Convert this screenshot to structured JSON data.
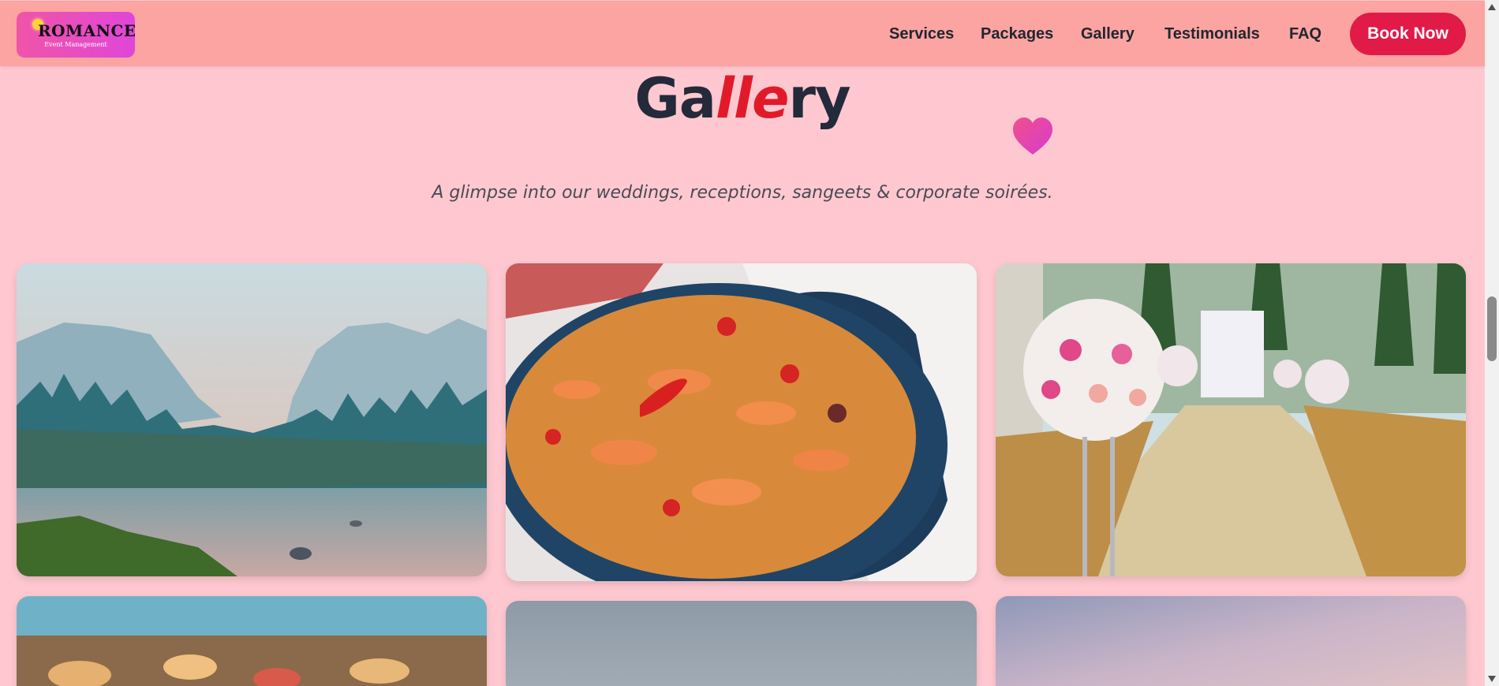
{
  "brand": {
    "logo_text": "ROMANCE",
    "logo_subtitle": "Event Management"
  },
  "nav": {
    "items": [
      "Services",
      "Packages",
      "Gallery",
      "Testimonials",
      "FAQ"
    ],
    "cta_label": "Book Now"
  },
  "hero": {
    "title_start": "Ga",
    "title_accent": "lle",
    "title_end": "ry",
    "subtitle": "A glimpse into our weddings, receptions, sangeets & corporate soirées."
  },
  "gallery": {
    "images": [
      {
        "subject": "misty mountain valley with river"
      },
      {
        "subject": "seafood paella in blue pot"
      },
      {
        "subject": "outdoor wedding aisle with rose bouquets"
      },
      {
        "subject": "catering buffet food"
      },
      {
        "subject": "grey sky"
      },
      {
        "subject": "pastel sunset sky"
      }
    ]
  },
  "colors": {
    "page_bg": "#ffc8d0",
    "header_bg": "#fba4a2",
    "cta_bg": "#e11a48",
    "title_text": "#232a3a",
    "title_accent": "#e11a2a",
    "heart": "#e83e8c"
  },
  "icons": {
    "heart": "heart-icon",
    "bulb": "lightbulb-icon"
  }
}
